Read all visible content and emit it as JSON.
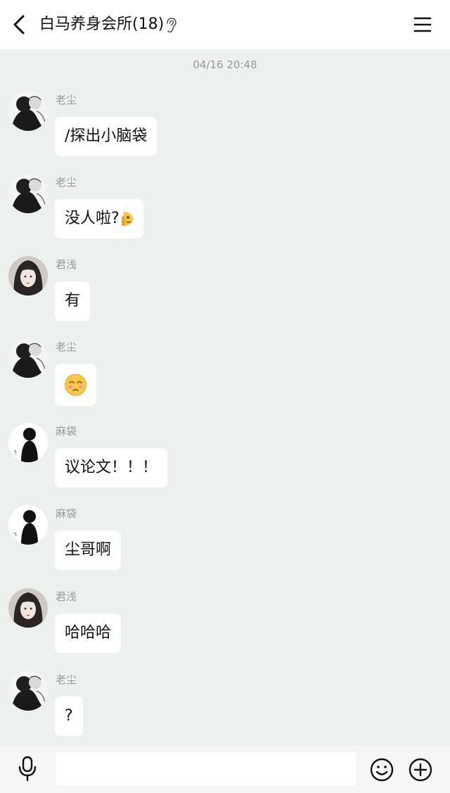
{
  "header": {
    "title": "白马养身会所(18)",
    "icons": {
      "back": "chevron-left-icon",
      "ear": "ear-icon",
      "menu": "hamburger-menu-icon"
    }
  },
  "chat": {
    "timestamp": "04/16 20:48",
    "messages": [
      {
        "sender": "老尘",
        "text": "/探出小脑袋",
        "avatar": "avatar-laochen"
      },
      {
        "sender": "老尘",
        "text": "没人啦?",
        "avatar": "avatar-laochen",
        "trailing_emoji": "peeking-face-emoji"
      },
      {
        "sender": "君浅",
        "text": "有",
        "avatar": "avatar-junqian"
      },
      {
        "sender": "老尘",
        "text": "",
        "avatar": "avatar-laochen",
        "emoji": "shy-face-emoji"
      },
      {
        "sender": "麻袋",
        "text": "议论文！！！",
        "avatar": "avatar-madai"
      },
      {
        "sender": "麻袋",
        "text": "尘哥啊",
        "avatar": "avatar-madai"
      },
      {
        "sender": "君浅",
        "text": "哈哈哈",
        "avatar": "avatar-junqian"
      },
      {
        "sender": "老尘",
        "text": "?",
        "avatar": "avatar-laochen"
      }
    ]
  },
  "footer": {
    "input_value": "",
    "icons": {
      "voice": "microphone-icon",
      "emoji": "smiley-icon",
      "more": "plus-circle-icon"
    }
  },
  "colors": {
    "background": "#EDF1EE",
    "header": "#FFFFFF",
    "bubble": "#FFFFFF",
    "footer": "#F6F6F6",
    "sender_name": "#9A9A9A",
    "timestamp": "#999999"
  }
}
